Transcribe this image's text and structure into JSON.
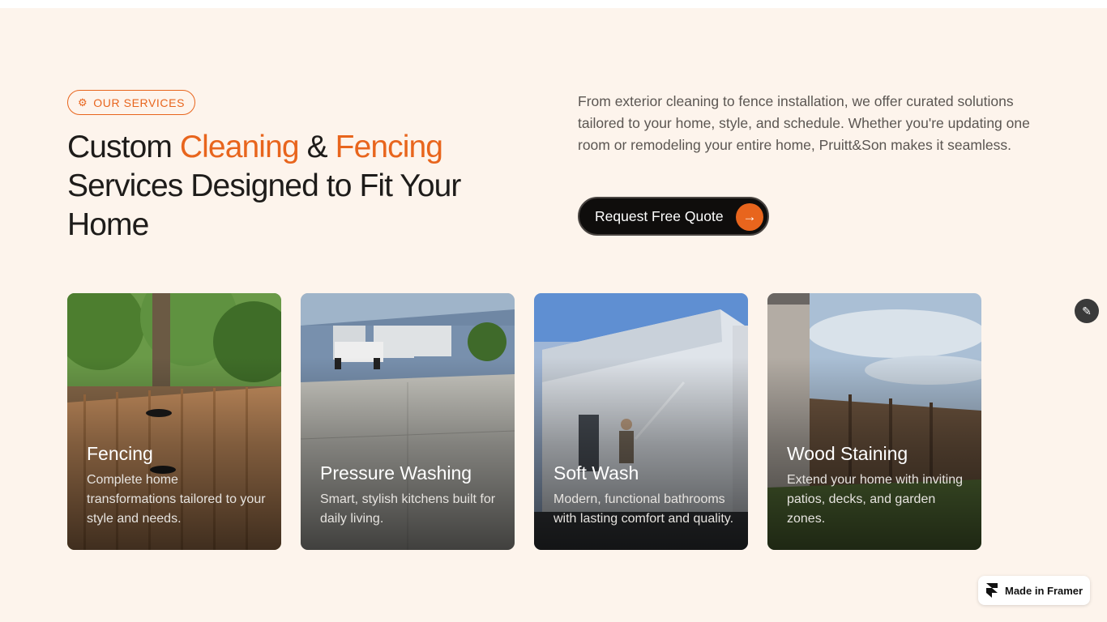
{
  "badge": {
    "label": "OUR SERVICES",
    "icon": "gear-icon"
  },
  "headline": {
    "part1": "Custom ",
    "accent1": "Cleaning",
    "part2": " & ",
    "accent2": "Fencing",
    "part3": " Services Designed to Fit Your Home"
  },
  "intro": "From exterior cleaning to fence installation, we offer curated solutions tailored to your home, style, and schedule. Whether you're updating one room or remodeling your entire home, Pruitt&Son makes it seamless.",
  "cta": {
    "label": "Request Free Quote",
    "icon": "arrow-right-icon"
  },
  "services": [
    {
      "title": "Fencing",
      "desc": "Complete home transformations tailored to your style and needs."
    },
    {
      "title": "Pressure Washing",
      "desc": "Smart, stylish kitchens built for daily living."
    },
    {
      "title": "Soft Wash",
      "desc": "Modern, functional bathrooms with lasting comfort and quality."
    },
    {
      "title": "Wood Staining",
      "desc": "Extend your home with inviting patios, decks, and garden zones."
    }
  ],
  "framer_badge": {
    "label": "Made in Framer",
    "icon": "framer-logo-icon"
  },
  "colors": {
    "accent": "#e8651d",
    "background": "#fdf4ec",
    "cta": "#0f0d0c"
  }
}
